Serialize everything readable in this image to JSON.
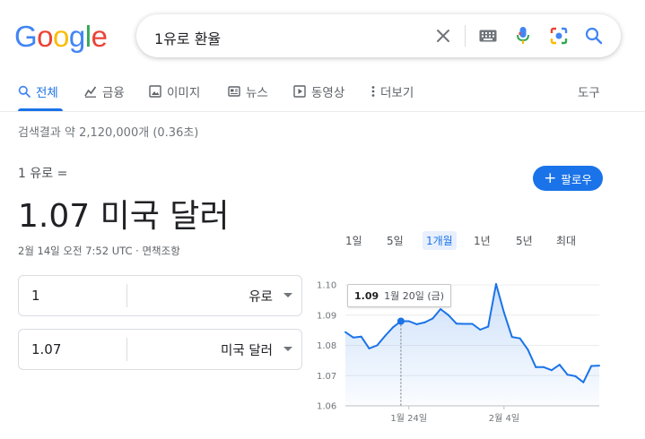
{
  "logo": {
    "text": "Google"
  },
  "search": {
    "query": "1유로 환율",
    "icons": [
      "close-icon",
      "keyboard-icon",
      "microphone-icon",
      "lens-camera-icon",
      "search-icon"
    ]
  },
  "tabs": [
    {
      "label": "전체",
      "icon": "search-icon",
      "active": true
    },
    {
      "label": "금융",
      "icon": "finance-chart-icon"
    },
    {
      "label": "이미지",
      "icon": "image-icon"
    },
    {
      "label": "뉴스",
      "icon": "news-icon"
    },
    {
      "label": "동영상",
      "icon": "play-icon"
    },
    {
      "label": "더보기",
      "icon": "more-vertical-icon"
    }
  ],
  "tools_label": "도구",
  "stats": "검색결과 약 2,120,000개 (0.36초)",
  "converter": {
    "from_line": "1 유로 =",
    "result": "1.07 미국 달러",
    "timestamp": "2월 14일 오전 7:52 UTC · 면책조항",
    "follow_label": "팔로우",
    "rows": [
      {
        "amount": "1",
        "currency": "유로"
      },
      {
        "amount": "1.07",
        "currency": "미국 달러"
      }
    ]
  },
  "time_ranges": [
    {
      "label": "1일"
    },
    {
      "label": "5일"
    },
    {
      "label": "1개월",
      "active": true
    },
    {
      "label": "1년"
    },
    {
      "label": "5년"
    },
    {
      "label": "최대"
    }
  ],
  "tooltip": {
    "value": "1.09",
    "date": "1월 20일 (금)"
  },
  "colors": {
    "accent": "#1a73e8",
    "line": "#1a73e8",
    "fill": "#e8f0fe"
  },
  "chart_data": {
    "type": "area",
    "y_ticks": [
      "1.10",
      "1.09",
      "1.08",
      "1.07",
      "1.06"
    ],
    "ylim": [
      1.06,
      1.1
    ],
    "x_ticks": [
      {
        "label": "1월 24일",
        "index": 8
      },
      {
        "label": "2월 4일",
        "index": 20
      }
    ],
    "hover_index": 7,
    "values": [
      1.0844,
      1.0826,
      1.0829,
      1.079,
      1.08,
      1.0831,
      1.086,
      1.088,
      1.088,
      1.087,
      1.0876,
      1.0889,
      1.092,
      1.09,
      1.0872,
      1.0871,
      1.0871,
      1.0852,
      1.0862,
      1.1003,
      1.0908,
      1.0828,
      1.0823,
      1.0786,
      1.0728,
      1.0728,
      1.0718,
      1.0736,
      1.0703,
      1.0698,
      1.0678,
      1.0732,
      1.0733
    ]
  }
}
